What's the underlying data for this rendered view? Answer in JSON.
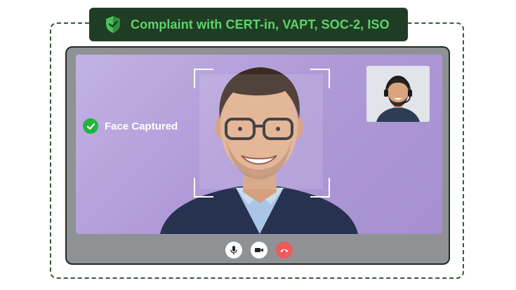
{
  "badge": {
    "text": "Complaint with CERT-in, VAPT, SOC-2, ISO",
    "icon": "shield-check-icon",
    "background": "#1f3d25",
    "text_color": "#5fd46a"
  },
  "video_call": {
    "status_text": "Face Captured",
    "status_icon": "check-circle-icon",
    "status_color": "#22b43c",
    "background": "#b09bd8"
  },
  "controls": [
    {
      "name": "mute",
      "icon": "microphone-icon"
    },
    {
      "name": "camera",
      "icon": "video-camera-icon"
    },
    {
      "name": "end-call",
      "icon": "phone-hangup-icon",
      "color": "#ef5a5a"
    }
  ]
}
